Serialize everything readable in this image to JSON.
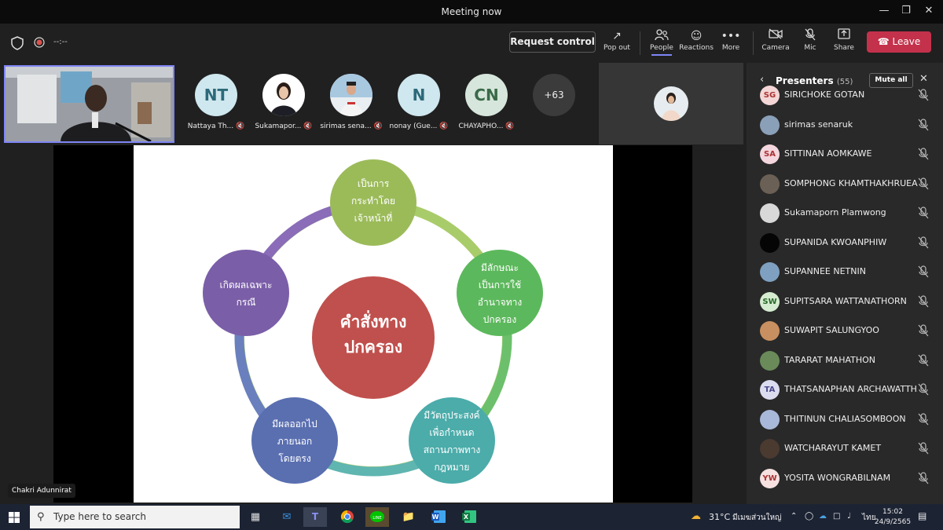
{
  "window": {
    "title": "Meeting now"
  },
  "meeting": {
    "timer": "--:--"
  },
  "toolbar": {
    "request_control": "Request control",
    "pop_out": "Pop out",
    "people": "People",
    "reactions": "Reactions",
    "more": "More",
    "camera": "Camera",
    "mic": "Mic",
    "share": "Share",
    "leave": "Leave"
  },
  "tiles": [
    {
      "initials": "NT",
      "name": "Nattaya Th...",
      "bg": "#cfe7ee"
    },
    {
      "initials": "",
      "name": "Sukamapor...",
      "bg": "#ffffff"
    },
    {
      "initials": "",
      "name": "sirimas sena...",
      "bg": "#e8eef2"
    },
    {
      "initials": "N",
      "name": "nonay (Gue...",
      "bg": "#cfe7ee"
    },
    {
      "initials": "CN",
      "name": "CHAYAPHO...",
      "bg": "#d7e6dc"
    }
  ],
  "overflow_count": "+63",
  "speaker_name": "Chakri Adunnirat",
  "slide": {
    "center": [
      "คำสั่งทาง",
      "ปกครอง"
    ],
    "nodes": [
      {
        "lines": [
          "เป็นการ",
          "กระทำโดย",
          "เจ้าหน้าที่"
        ],
        "color": "#9bbb59"
      },
      {
        "lines": [
          "มีลักษณะ",
          "เป็นการใช้",
          "อำนาจทาง",
          "ปกครอง"
        ],
        "color": "#5cb85c"
      },
      {
        "lines": [
          "มีวัตถุประสงค์",
          "เพื่อกำหนด",
          "สถานภาพทาง",
          "กฎหมาย"
        ],
        "color": "#4bacaa"
      },
      {
        "lines": [
          "มีผลออกไป",
          "ภายนอก",
          "โดยตรง"
        ],
        "color": "#5a6fb0"
      },
      {
        "lines": [
          "เกิดผลเฉพาะ",
          "กรณี"
        ],
        "color": "#7b5ea8"
      }
    ],
    "center_color": "#c0504d"
  },
  "panel": {
    "title": "Presenters",
    "count": "(55)",
    "mute_all": "Mute all",
    "people": [
      {
        "name": "SIRICHOKE GOTAN",
        "initials": "SG",
        "bg": "#f4d6d6",
        "fg": "#a33"
      },
      {
        "name": "sirimas senaruk",
        "initials": "",
        "bg": "#8aa0b8",
        "fg": "#fff"
      },
      {
        "name": "SITTINAN AOMKAWE",
        "initials": "SA",
        "bg": "#f4d6de",
        "fg": "#a33"
      },
      {
        "name": "SOMPHONG KHAMTHAKHRUEA",
        "initials": "",
        "bg": "#6b6055",
        "fg": "#fff"
      },
      {
        "name": "Sukamaporn Plamwong",
        "initials": "",
        "bg": "#d8d8d8",
        "fg": "#333"
      },
      {
        "name": "SUPANIDA KWOANPHIW",
        "initials": "",
        "bg": "#050505",
        "fg": "#fff"
      },
      {
        "name": "SUPANNEE NETNIN",
        "initials": "",
        "bg": "#7fa0c0",
        "fg": "#fff"
      },
      {
        "name": "SUPITSARA WATTANATHORN",
        "initials": "SW",
        "bg": "#d5ecd0",
        "fg": "#2a6a2a"
      },
      {
        "name": "SUWAPIT SALUNGYOO",
        "initials": "",
        "bg": "#c89060",
        "fg": "#fff"
      },
      {
        "name": "TARARAT MAHATHON",
        "initials": "",
        "bg": "#6a8a5a",
        "fg": "#fff"
      },
      {
        "name": "THATSANAPHAN ARCHAWATTH...",
        "initials": "TA",
        "bg": "#dcdcf0",
        "fg": "#4a4a8a"
      },
      {
        "name": "THITINUN CHALIASOMBOON",
        "initials": "",
        "bg": "#a8b8d8",
        "fg": "#fff"
      },
      {
        "name": "WATCHARAYUT KAMET",
        "initials": "",
        "bg": "#4a3a30",
        "fg": "#fff"
      },
      {
        "name": "YOSITA WONGRABILNAM",
        "initials": "YW",
        "bg": "#f6e0e0",
        "fg": "#a33"
      }
    ]
  },
  "taskbar": {
    "search_placeholder": "Type here to search",
    "temperature": "31°C",
    "weather": "มีเมฆส่วนใหญ่",
    "language": "ไทย",
    "time": "15:02",
    "date": "24/9/2565"
  },
  "colors": {
    "accent": "#7f85f5",
    "leave": "#c4314b"
  }
}
